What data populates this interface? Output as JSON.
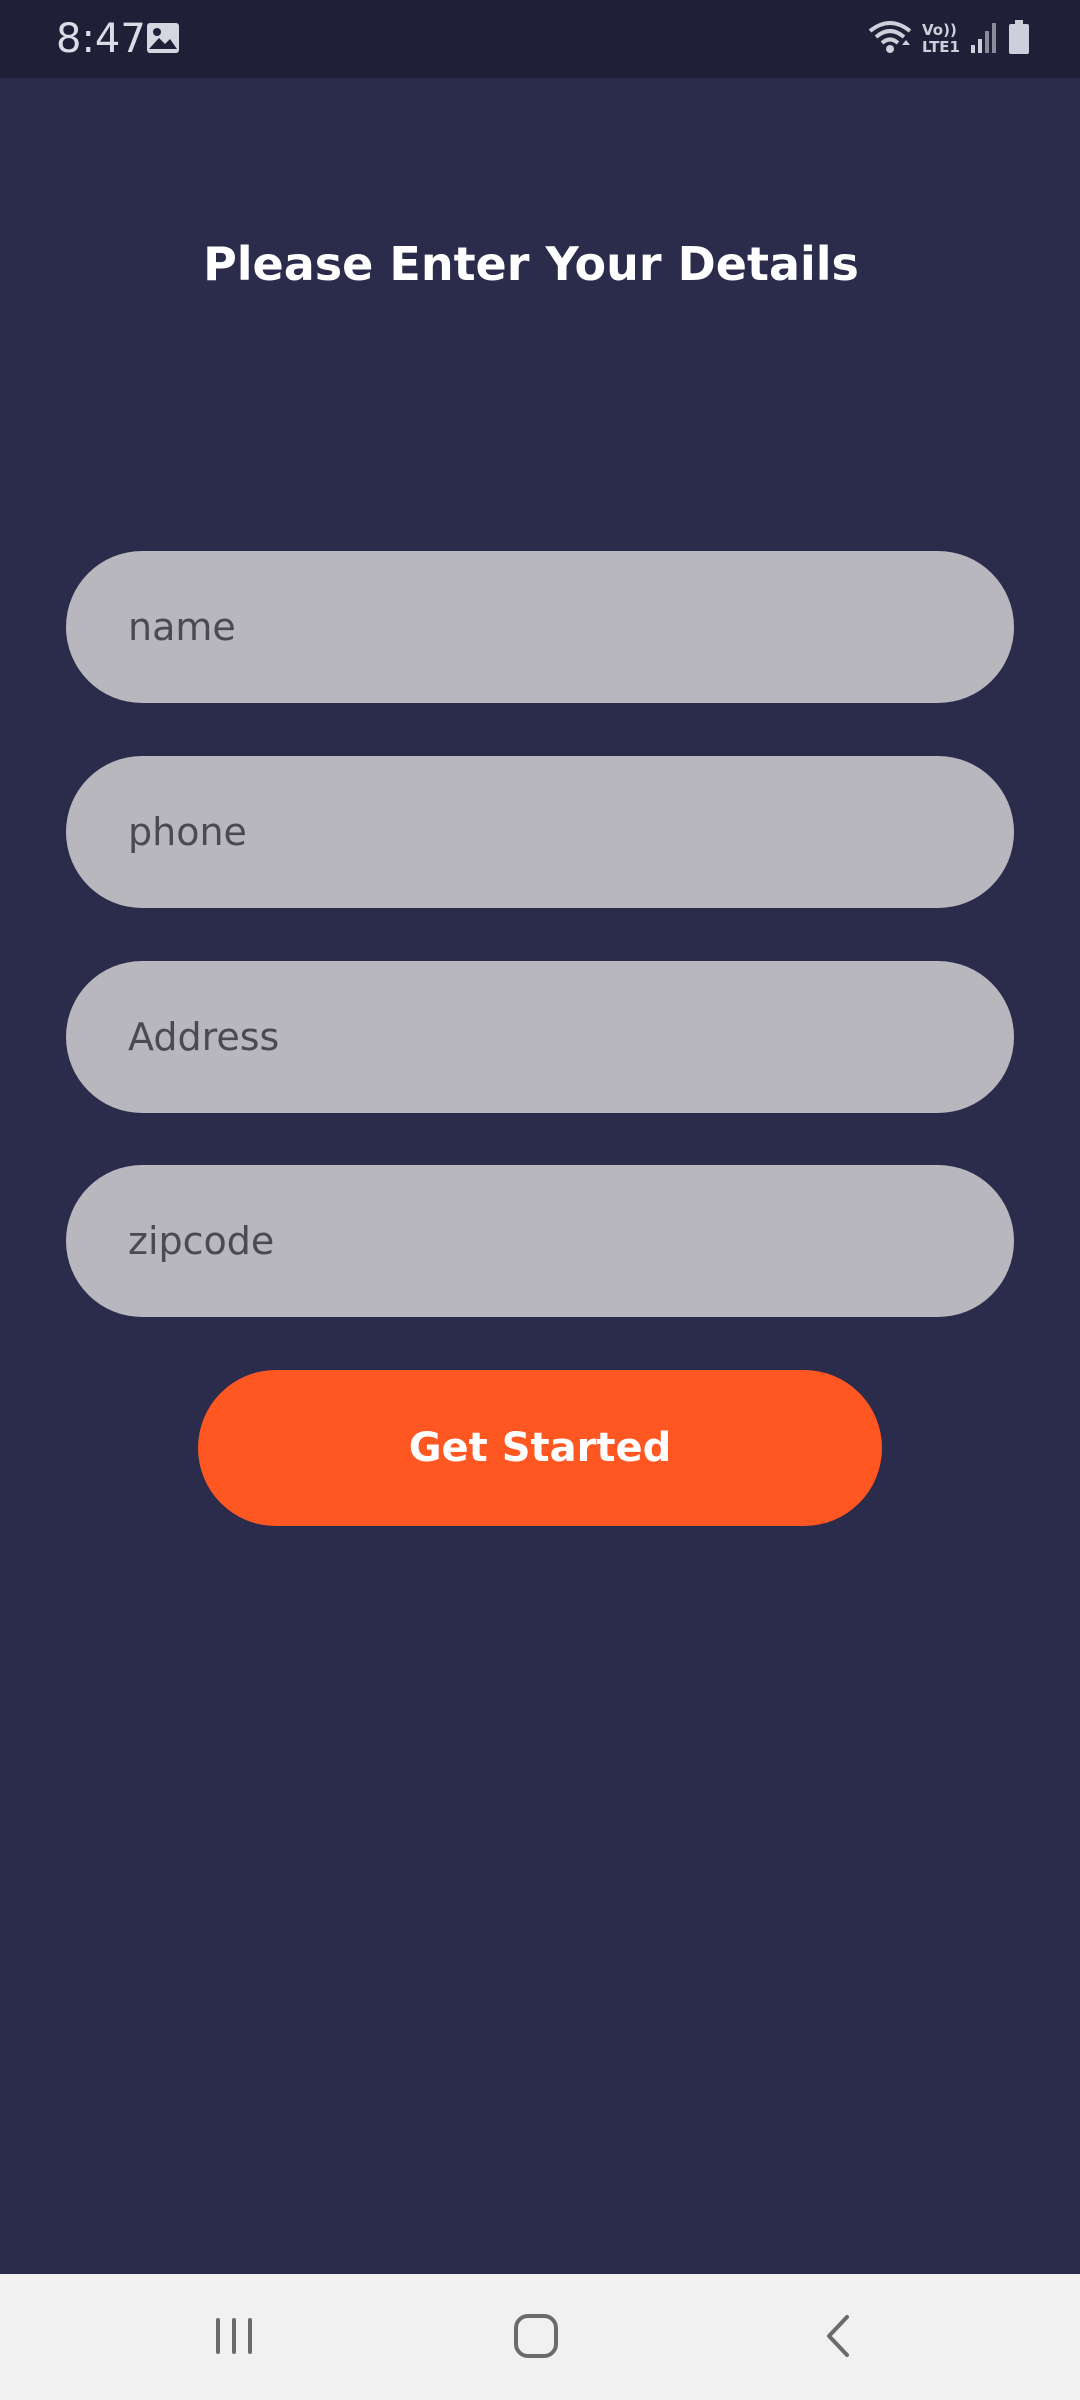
{
  "status_bar": {
    "time": "8:47",
    "network_top": "Vo))",
    "network_bottom": "LTE1",
    "icons": [
      "gallery-icon",
      "wifi-icon",
      "signal-icon",
      "battery-icon"
    ]
  },
  "page": {
    "title": "Please Enter Your Details"
  },
  "form": {
    "name_placeholder": "name",
    "phone_placeholder": "phone",
    "address_placeholder": "Address",
    "zipcode_placeholder": "zipcode",
    "submit_label": "Get Started"
  },
  "nav_bar": {
    "buttons": [
      "recents-icon",
      "home-icon",
      "back-icon"
    ]
  },
  "colors": {
    "background": "#2b2b4b",
    "status_bar": "#1f1f38",
    "field_bg": "#b7b7bd",
    "accent": "#ff5722",
    "nav_bar": "#f1f1f1"
  }
}
